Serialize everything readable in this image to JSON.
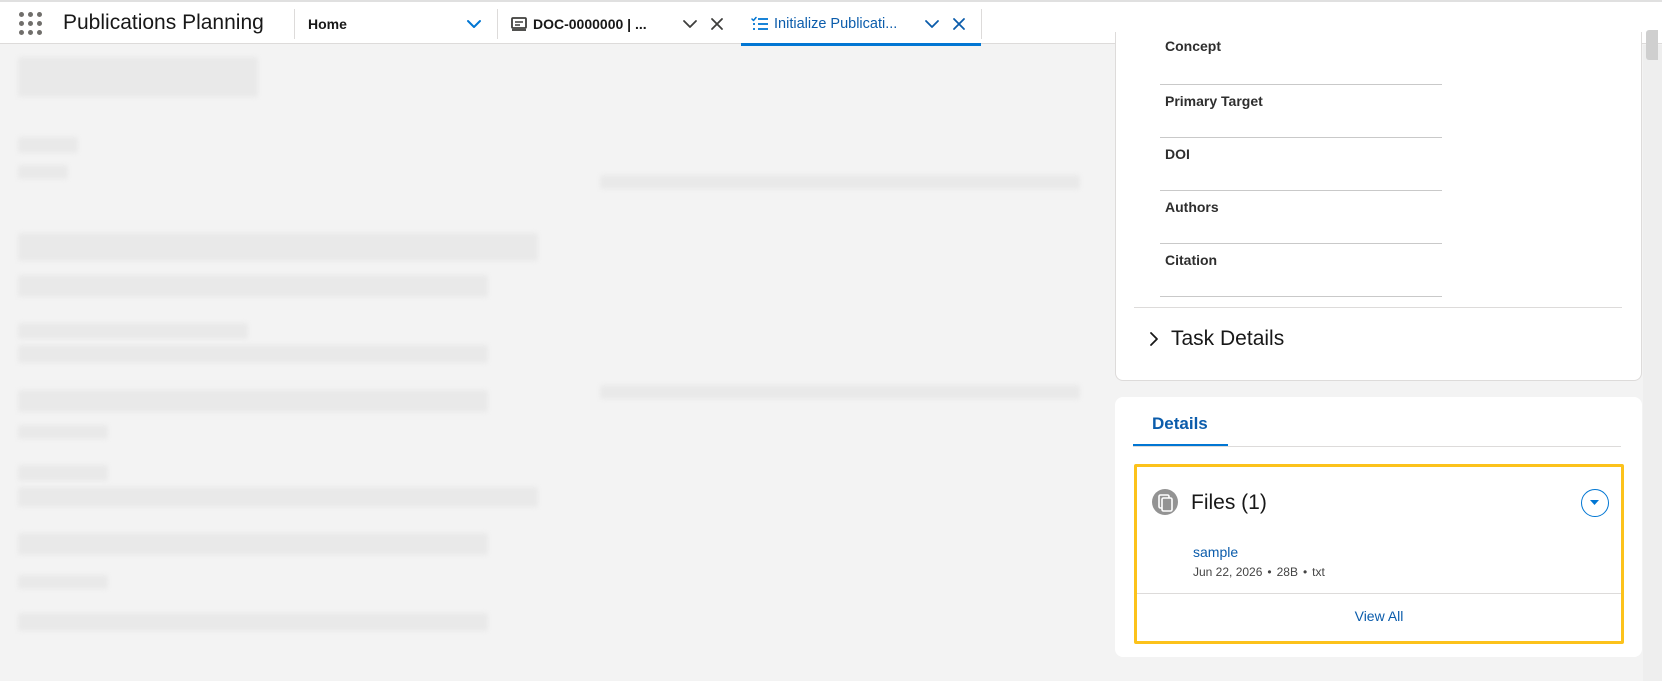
{
  "app": {
    "name": "Publications Planning"
  },
  "tabs": {
    "home": {
      "label": "Home"
    },
    "items": [
      {
        "label": "DOC-0000000 | ...",
        "icon": "document-record-icon"
      },
      {
        "label": "Initialize Publicati...",
        "icon": "task-list-icon",
        "active": true
      }
    ]
  },
  "record": {
    "fields": [
      {
        "label": "Concept"
      },
      {
        "label": "Primary Target"
      },
      {
        "label": "DOI"
      },
      {
        "label": "Authors"
      },
      {
        "label": "Citation"
      }
    ],
    "task_details": {
      "label": "Task Details"
    }
  },
  "details": {
    "tab_label": "Details",
    "files": {
      "title": "Files (1)",
      "items": [
        {
          "name": "sample",
          "date": "Jun 22, 2026",
          "size": "28B",
          "type": "txt"
        }
      ],
      "view_all": "View All"
    }
  },
  "colors": {
    "accent": "#0176d3",
    "link": "#0b5cab",
    "highlight_border": "#fcc21b"
  }
}
